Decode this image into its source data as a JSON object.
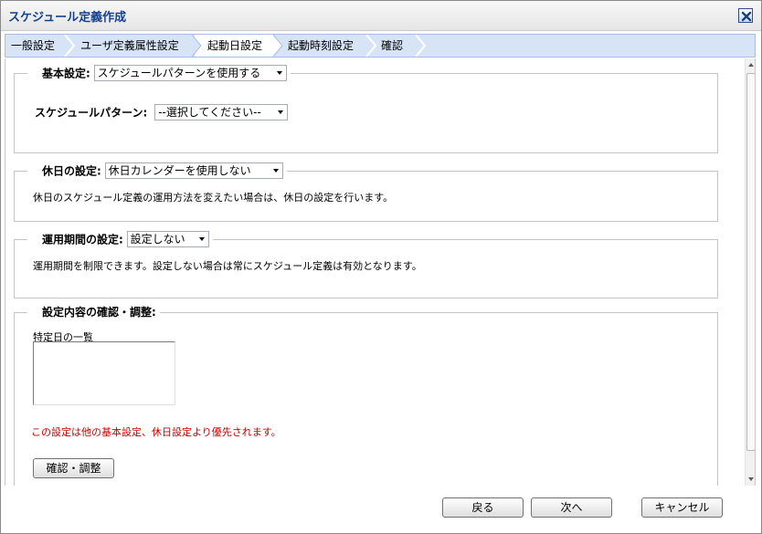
{
  "window": {
    "title": "スケジュール定義作成"
  },
  "wizard": {
    "steps": [
      "一般設定",
      "ユーザ定義属性設定",
      "起動日設定",
      "起動時刻設定",
      "確認"
    ],
    "active_index": 2
  },
  "basic": {
    "legend": "基本設定:",
    "selected": "スケジュールパターンを使用する",
    "pattern_label": "スケジュールパターン:",
    "pattern_selected": "--選択してください--"
  },
  "holiday": {
    "legend": "休日の設定:",
    "selected": "休日カレンダーを使用しない",
    "description": "休日のスケジュール定義の運用方法を変えたい場合は、休日の設定を行います。"
  },
  "period": {
    "legend": "運用期間の設定:",
    "selected": "設定しない",
    "description": "運用期間を制限できます。設定しない場合は常にスケジュール定義は有効となります。"
  },
  "review": {
    "legend": "設定内容の確認・調整:",
    "list_label": "特定日の一覧",
    "warning": "この設定は他の基本設定、休日設定より優先されます。",
    "button": "確認・調整"
  },
  "footer": {
    "back": "戻る",
    "next": "次へ",
    "cancel": "キャンセル"
  },
  "colors": {
    "title": "#15428b",
    "warning": "#cc0000",
    "wizard_bg": "#d6e4f5"
  }
}
